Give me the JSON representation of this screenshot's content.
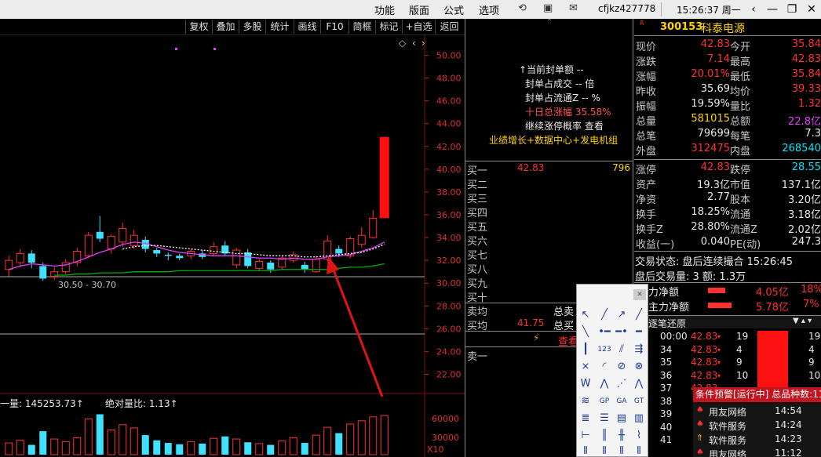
{
  "menu": [
    "功能",
    "版面",
    "公式",
    "选项"
  ],
  "account": "cfjkz427778",
  "clock": "15:26:37 周一",
  "chart_toolbar": [
    "复权",
    "叠加",
    "多股",
    "统计",
    "画线",
    "F10",
    "简框",
    "标记",
    "+自选",
    "返回"
  ],
  "price_axis": [
    "50.00",
    "48.00",
    "46.00",
    "44.00",
    "42.00",
    "40.00",
    "38.00",
    "36.00",
    "34.00",
    "32.00",
    "30.00",
    "28.00",
    "26.00",
    "24.00",
    "22.00"
  ],
  "low_range_label": "30.50 - 30.70",
  "volume_label": "一量: 145253.73↑",
  "ratio_label": "绝对量比: 1.13↑",
  "volume_axis": [
    "60000",
    "30000"
  ],
  "volume_unit": "X10",
  "chart_data": {
    "type": "candlestick",
    "ylim": [
      21,
      51
    ],
    "candles": [
      {
        "o": 31.2,
        "c": 32.0,
        "h": 32.4,
        "l": 30.6
      },
      {
        "o": 31.8,
        "c": 32.6,
        "h": 33.0,
        "l": 31.4
      },
      {
        "o": 32.6,
        "c": 31.8,
        "h": 32.9,
        "l": 31.3
      },
      {
        "o": 31.5,
        "c": 30.4,
        "h": 31.8,
        "l": 30.2
      },
      {
        "o": 30.6,
        "c": 31.0,
        "h": 31.4,
        "l": 30.3
      },
      {
        "o": 31.0,
        "c": 31.8,
        "h": 32.1,
        "l": 30.8
      },
      {
        "o": 31.8,
        "c": 32.8,
        "h": 33.1,
        "l": 31.5
      },
      {
        "o": 32.4,
        "c": 34.2,
        "h": 34.5,
        "l": 32.2
      },
      {
        "o": 34.5,
        "c": 33.9,
        "h": 35.9,
        "l": 33.6
      },
      {
        "o": 33.0,
        "c": 34.1,
        "h": 34.3,
        "l": 32.6
      },
      {
        "o": 33.6,
        "c": 34.8,
        "h": 35.3,
        "l": 33.2
      },
      {
        "o": 33.3,
        "c": 34.2,
        "h": 34.7,
        "l": 33.0
      },
      {
        "o": 33.8,
        "c": 33.0,
        "h": 34.1,
        "l": 32.7
      },
      {
        "o": 32.9,
        "c": 32.6,
        "h": 33.1,
        "l": 32.3
      },
      {
        "o": 32.5,
        "c": 32.4,
        "h": 32.7,
        "l": 32.0
      },
      {
        "o": 32.4,
        "c": 32.2,
        "h": 32.6,
        "l": 32.0
      },
      {
        "o": 32.4,
        "c": 32.8,
        "h": 33.0,
        "l": 32.1
      },
      {
        "o": 32.6,
        "c": 32.3,
        "h": 32.9,
        "l": 32.1
      },
      {
        "o": 32.6,
        "c": 33.2,
        "h": 33.6,
        "l": 32.4
      },
      {
        "o": 33.3,
        "c": 32.6,
        "h": 33.7,
        "l": 32.4
      },
      {
        "o": 31.6,
        "c": 32.9,
        "h": 33.1,
        "l": 31.3
      },
      {
        "o": 32.7,
        "c": 31.5,
        "h": 33.0,
        "l": 31.3
      },
      {
        "o": 31.3,
        "c": 31.9,
        "h": 32.1,
        "l": 31.1
      },
      {
        "o": 31.8,
        "c": 31.2,
        "h": 32.0,
        "l": 30.9
      },
      {
        "o": 31.4,
        "c": 32.2,
        "h": 32.4,
        "l": 31.2
      },
      {
        "o": 32.0,
        "c": 32.5,
        "h": 32.8,
        "l": 31.8
      },
      {
        "o": 31.6,
        "c": 31.2,
        "h": 31.9,
        "l": 30.9
      },
      {
        "o": 31.0,
        "c": 32.1,
        "h": 32.4,
        "l": 30.9
      },
      {
        "o": 32.1,
        "c": 33.7,
        "h": 34.2,
        "l": 31.9
      },
      {
        "o": 33.0,
        "c": 32.6,
        "h": 33.3,
        "l": 32.3
      },
      {
        "o": 32.4,
        "c": 33.9,
        "h": 34.1,
        "l": 32.2
      },
      {
        "o": 33.4,
        "c": 34.2,
        "h": 34.9,
        "l": 33.1
      },
      {
        "o": 34.0,
        "c": 35.7,
        "h": 36.4,
        "l": 33.9
      },
      {
        "o": 35.7,
        "c": 42.83,
        "h": 42.83,
        "l": 35.69
      }
    ],
    "volumes": [
      18000,
      22000,
      15000,
      36000,
      24000,
      20000,
      26000,
      55000,
      62000,
      38000,
      46000,
      41000,
      30000,
      22000,
      18000,
      16000,
      20000,
      17000,
      25000,
      28000,
      24000,
      19000,
      17000,
      15000,
      21000,
      26000,
      18000,
      30000,
      42000,
      33000,
      47000,
      52000,
      58000,
      60000
    ],
    "ma_magenta": [
      31.2,
      31.5,
      31.7,
      31.6,
      31.5,
      31.6,
      31.9,
      32.3,
      32.7,
      33.0,
      33.4,
      33.6,
      33.5,
      33.2,
      32.9,
      32.7,
      32.6,
      32.5,
      32.4,
      32.4,
      32.4,
      32.3,
      32.2,
      32.2,
      32.1,
      32.2,
      32.1,
      32.1,
      32.3,
      32.4,
      32.5,
      32.8,
      33.1,
      33.6
    ],
    "ma_white": [
      null,
      null,
      null,
      null,
      null,
      null,
      null,
      null,
      null,
      null,
      33.0,
      33.2,
      33.3,
      33.3,
      33.2,
      33.1,
      33.0,
      32.9,
      32.8,
      32.7,
      32.6,
      32.6,
      32.5,
      32.4,
      32.4,
      32.4,
      32.3,
      32.3,
      32.4,
      32.5,
      32.6,
      32.7,
      33.0,
      33.4
    ],
    "ma_green": [
      null,
      null,
      null,
      null,
      30.7,
      30.7,
      30.8,
      30.8,
      30.9,
      30.9,
      30.9,
      31.0,
      31.0,
      31.0,
      31.0,
      31.1,
      31.1,
      31.1,
      31.1,
      31.1,
      31.1,
      31.1,
      31.1,
      31.1,
      31.2,
      31.2,
      31.2,
      31.2,
      31.2,
      31.3,
      31.4,
      31.4,
      31.5,
      31.7
    ]
  },
  "mid": {
    "info_lines": [
      "↑当前封单额 --",
      "封单占成交 -- 倍",
      "封单占流通Z -- %",
      "十日总涨幅 35.58%",
      "继续涨停概率 查看",
      "业绩增长+数据中心+发电机组"
    ],
    "buy1_label": "买一",
    "buy1_price": "42.83",
    "buy1_volume": "796",
    "buy_levels": [
      "买二",
      "买三",
      "买四",
      "买五",
      "买六",
      "买七",
      "买八",
      "买九",
      "买十"
    ],
    "sell_avg_label": "卖均",
    "total_sell_label": "总卖",
    "buy_avg_label": "买均",
    "buy_avg_price": "41.75",
    "total_buy_label": "总买",
    "view_label": "查看",
    "sell1_label": "卖一"
  },
  "quote": {
    "code": "300153",
    "name": "科泰电源",
    "rows": [
      {
        "l1": "现价",
        "v1": "42.83",
        "c1": "red",
        "l2": "今开",
        "v2": "35.84",
        "c2": "red"
      },
      {
        "l1": "涨跌",
        "v1": "7.14",
        "c1": "red",
        "l2": "最高",
        "v2": "42.83",
        "c2": "red"
      },
      {
        "l1": "涨幅",
        "v1": "20.01%",
        "c1": "red",
        "l2": "最低",
        "v2": "35.84",
        "c2": "red"
      },
      {
        "l1": "昨收",
        "v1": "35.69",
        "c1": "white",
        "l2": "均价",
        "v2": "39.33",
        "c2": "red"
      },
      {
        "l1": "振幅",
        "v1": "19.59%",
        "c1": "white",
        "l2": "量比",
        "v2": "1.32",
        "c2": "red"
      },
      {
        "l1": "总量",
        "v1": "581015",
        "c1": "yellow",
        "l2": "总额",
        "v2": "22.8亿",
        "c2": "magenta"
      },
      {
        "l1": "总笔",
        "v1": "79699",
        "c1": "white",
        "l2": "每笔",
        "v2": "7.3",
        "c2": "white"
      },
      {
        "l1": "外盘",
        "v1": "312475",
        "c1": "red",
        "l2": "内盘",
        "v2": "268540",
        "c2": "cyan"
      },
      {
        "l1": "涨停",
        "v1": "42.83",
        "c1": "red",
        "l2": "跌停",
        "v2": "28.55",
        "c2": "cyan"
      },
      {
        "l1": "资产",
        "v1": "19.3亿",
        "c1": "white",
        "l2": "市值",
        "v2": "137.1亿",
        "c2": "white"
      },
      {
        "l1": "净资",
        "v1": "2.77",
        "c1": "white",
        "l2": "股本",
        "v2": "3.20亿",
        "c2": "white"
      },
      {
        "l1": "换手",
        "v1": "18.25%",
        "c1": "white",
        "l2": "流通",
        "v2": "3.18亿",
        "c2": "white"
      },
      {
        "l1": "换手Z",
        "v1": "28.80%",
        "c1": "white",
        "l2": "流通Z",
        "v2": "2.02亿",
        "c2": "white"
      },
      {
        "l1": "收益(一)",
        "v1": "0.040",
        "c1": "white",
        "l2": "PE(动)",
        "v2": "247.3",
        "c2": "white"
      }
    ],
    "trade_status": "交易状态: 盘后连续撮合 15:26:45",
    "after_volume": "盘后交易量: 3  额: 1.3万",
    "inflow_label": "力净额",
    "inflow_value": "4.05亿",
    "inflow_pct": "18%",
    "main_inflow_label": "主力净额",
    "main_inflow_value": "5.78亿",
    "main_inflow_pct": "7%",
    "tick_title": "逐笔还原",
    "ticks": [
      {
        "t": "00:00",
        "p": "42.83",
        "v": "19",
        "v2": "19"
      },
      {
        "t": "34",
        "p": "42.83",
        "v": "4",
        "v2": "4"
      },
      {
        "t": "35",
        "p": "42.83",
        "v": "9",
        "v2": "9"
      },
      {
        "t": "36",
        "p": "42.83",
        "v": "10",
        "v2": "10"
      },
      {
        "t": "37",
        "p": "42.83",
        "v": "",
        "v2": ""
      },
      {
        "t": "38",
        "p": "",
        "v": "",
        "v2": ""
      },
      {
        "t": "39",
        "p": "",
        "v": "",
        "v2": ""
      },
      {
        "t": "40",
        "p": "",
        "v": "",
        "v2": ""
      },
      {
        "t": "41",
        "p": "",
        "v": "",
        "v2": ""
      }
    ]
  },
  "alert": {
    "title": "条件预警[运行中] 总品种数:11",
    "rows": [
      {
        "name": "用友网络",
        "time": "14:54",
        "icon": "bell-icon"
      },
      {
        "name": "软件服务",
        "time": "14:24",
        "icon": "bell-icon"
      },
      {
        "name": "软件服务",
        "time": "14:23",
        "icon": "up-arrow-icon"
      },
      {
        "name": "用友网络",
        "time": "11:12",
        "icon": "bell-icon"
      }
    ]
  },
  "colors": {
    "up": "#ff3232",
    "down": "#40e0ff",
    "ma_magenta": "#e040fb",
    "ma_green": "#00b000",
    "limit_bar": "#ff1010"
  }
}
